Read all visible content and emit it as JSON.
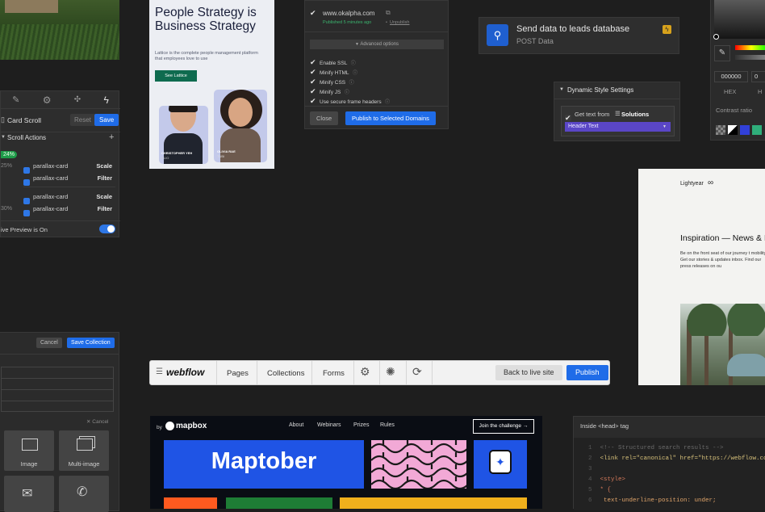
{
  "scroll_panel": {
    "title": "Card Scroll",
    "reset_label": "Reset",
    "save_label": "Save",
    "section_label": "Scroll Actions",
    "add_symbol": "+",
    "markers": [
      "24%",
      "25%",
      "30%"
    ],
    "rows": [
      {
        "label": "parallax-card",
        "action": "Scale"
      },
      {
        "label": "parallax-card",
        "action": "Filter"
      },
      {
        "label": "parallax-card",
        "action": "Scale"
      },
      {
        "label": "parallax-card",
        "action": "Filter"
      }
    ],
    "live_preview_label": "ive Preview is On"
  },
  "lattice_card": {
    "headline": "People Strategy is Business Strategy",
    "subtext": "Lattice is the complete people management platform that employees love to use",
    "cta_label": "See Lattice",
    "person1_name": "CHRISTOPHER YEH",
    "person1_role": "CLIO",
    "person2_name": "OLIVIA RAE",
    "person2_role": "TUBI"
  },
  "publish_panel": {
    "domain": "www.okalpha.com",
    "published_text": "Published 5 minutes ago",
    "unpublish_label": "Unpublish",
    "advanced_label": "Advanced options",
    "options": [
      "Enable SSL",
      "Minify HTML",
      "Minify CSS",
      "Minify JS",
      "Use secure frame headers"
    ],
    "close_label": "Close",
    "publish_label": "Publish to Selected Domains"
  },
  "leads_card": {
    "title": "Send data to leads database",
    "subtitle": "POST Data"
  },
  "dynamic_style": {
    "title": "Dynamic Style Settings",
    "get_text_prefix": "Get text from",
    "source": "Solutions",
    "field": "Header Text"
  },
  "color_picker": {
    "hex_value": "000000",
    "second_value": "0",
    "hex_label": "HEX",
    "second_label": "H",
    "contrast_label": "Contrast ratio"
  },
  "lightyear": {
    "brand": "Lightyear",
    "heading": "Inspiration — News & I",
    "body": "Be on the front seat of our journey t mobility. Get our stories & updates inbox. Find our press releases on ou"
  },
  "collection_panel": {
    "cancel_label": "Cancel",
    "save_label": "Save Collection",
    "cancel_small": "Cancel",
    "tiles": [
      "Image",
      "Multi-image"
    ]
  },
  "webflow_bar": {
    "logo": "webflow",
    "nav": [
      "Pages",
      "Collections",
      "Forms"
    ],
    "back_label": "Back to live site",
    "publish_label": "Publish"
  },
  "mapbox_card": {
    "by_label": "by",
    "brand": "mapbox",
    "nav": [
      "About",
      "Webinars",
      "Prizes",
      "Rules"
    ],
    "cta_label": "Join the challenge →",
    "hero_title": "Maptober"
  },
  "code_panel": {
    "title": "Inside <head> tag",
    "lines": [
      {
        "num": "1",
        "text": "<!-- Structured search results -->"
      },
      {
        "num": "2",
        "text": "<link rel=\"canonical\" href=\"https://webflow.co"
      },
      {
        "num": "3",
        "text": ""
      },
      {
        "num": "4",
        "text": "<style>"
      },
      {
        "num": "5",
        "text": "* {"
      },
      {
        "num": "6",
        "text": "  text-underline-position: under;"
      }
    ]
  },
  "colors": {
    "background": "#1e1e1e",
    "panel": "#2b2b2b",
    "accent_blue": "#1f6ce8",
    "mapbox_blue": "#1f54e5",
    "lattice_green": "#0f6b4f"
  }
}
